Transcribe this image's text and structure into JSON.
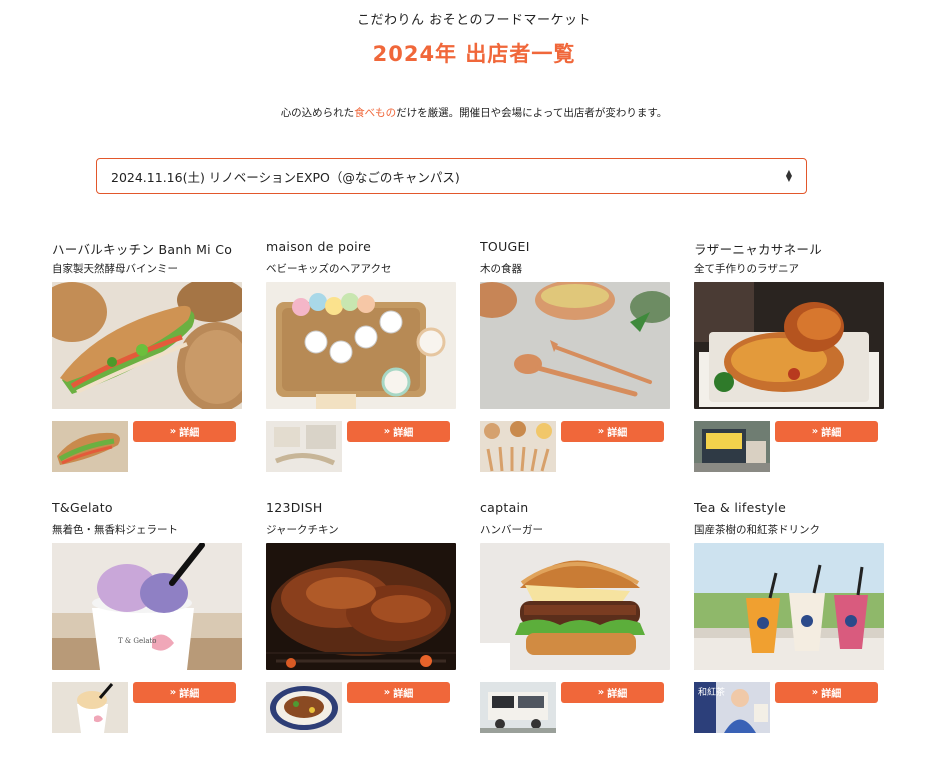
{
  "header": {
    "site_name": "こだわりん おそとのフードマーケット",
    "title": "2024年 出店者一覧",
    "lead_before": "心の込められた",
    "lead_highlight": "食べもの",
    "lead_after": "だけを厳選。開催日や会場によって出店者が変わります。"
  },
  "event_select": {
    "selected": "2024.11.16(土) リノベーションEXPO（@なごのキャンパス)"
  },
  "vendors": [
    {
      "name": "ハーバルキッチン Banh Mi Co",
      "desc": "自家製天然酵母バインミー",
      "button": "詳細"
    },
    {
      "name": "maison de poire",
      "desc": "ベビーキッズのヘアアクセ",
      "button": "詳細"
    },
    {
      "name": "TOUGEI",
      "desc": "木の食器",
      "button": "詳細"
    },
    {
      "name": "ラザーニャカサネール",
      "desc": "全て手作りのラザニア",
      "button": "詳細"
    },
    {
      "name": "T&Gelato",
      "desc": "無着色・無香料ジェラート",
      "button": "詳細"
    },
    {
      "name": "123DISH",
      "desc": "ジャークチキン",
      "button": "詳細"
    },
    {
      "name": "captain",
      "desc": "ハンバーガー",
      "button": "詳細"
    },
    {
      "name": "Tea & lifestyle",
      "desc": "国産茶樹の和紅茶ドリンク",
      "button": "詳細"
    }
  ],
  "image_text": {
    "gelato_cup": "T & Gelato",
    "tea_banner": "和紅茶"
  },
  "colors": {
    "accent": "#f0673a",
    "select_border": "#e2572b"
  }
}
